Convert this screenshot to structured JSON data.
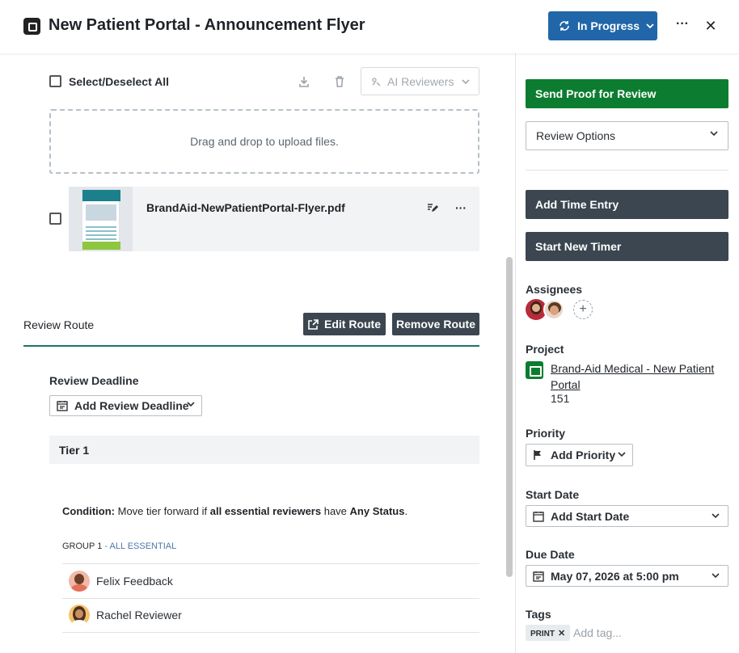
{
  "header": {
    "title": "New Patient Portal - Announcement Flyer",
    "status": "In Progress",
    "more": "···",
    "close": "✕"
  },
  "files": {
    "select_all_label": "Select/Deselect All",
    "ai_reviewers_label": "AI Reviewers",
    "dropzone_text": "Drag and drop to upload files.",
    "items": [
      {
        "name": "BrandAid-NewPatientPortal-Flyer.pdf"
      }
    ]
  },
  "review_route": {
    "title": "Review Route",
    "edit_label": "Edit Route",
    "remove_label": "Remove Route",
    "deadline_label": "Review Deadline",
    "add_deadline_label": "Add Review Deadline",
    "tier_label": "Tier 1",
    "condition_label": "Condition:",
    "condition_text_1": "Move tier forward if",
    "condition_bold_1": "all essential reviewers",
    "condition_text_2": "have",
    "condition_bold_2": "Any Status",
    "condition_end": ".",
    "group_label": "GROUP 1",
    "group_sep": " - ",
    "group_type": "ALL ESSENTIAL",
    "reviewers": [
      {
        "name": "Felix Feedback"
      },
      {
        "name": "Rachel Reviewer"
      }
    ]
  },
  "sidebar": {
    "send_proof_label": "Send Proof for Review",
    "review_options_label": "Review Options",
    "add_time_label": "Add Time Entry",
    "start_timer_label": "Start New Timer",
    "assignees_label": "Assignees",
    "project_label": "Project",
    "project_name": "Brand-Aid Medical - New Patient Portal",
    "project_id": "151",
    "priority_label": "Priority",
    "add_priority_label": "Add Priority",
    "start_date_label": "Start Date",
    "add_start_date_label": "Add Start Date",
    "due_date_label": "Due Date",
    "due_date_value": "May 07, 2026 at 5:00 pm",
    "tags_label": "Tags",
    "tags": [
      "PRINT"
    ],
    "tag_placeholder": "Add tag..."
  },
  "colors": {
    "status_button": "#2166a8",
    "send_proof": "#0c7d30",
    "dark_button": "#3b4650",
    "route_accent": "#1e7565",
    "group_accent": "#4c78a8"
  },
  "icons": [
    "logo-icon",
    "sync-icon",
    "chevron-down-icon",
    "more-icon",
    "close-icon",
    "download-icon",
    "trash-icon",
    "ai-reviewers-icon",
    "edit-proof-icon",
    "external-link-icon",
    "calendar-icon",
    "flag-icon",
    "folder-icon",
    "plus-icon",
    "tag-remove-icon"
  ]
}
